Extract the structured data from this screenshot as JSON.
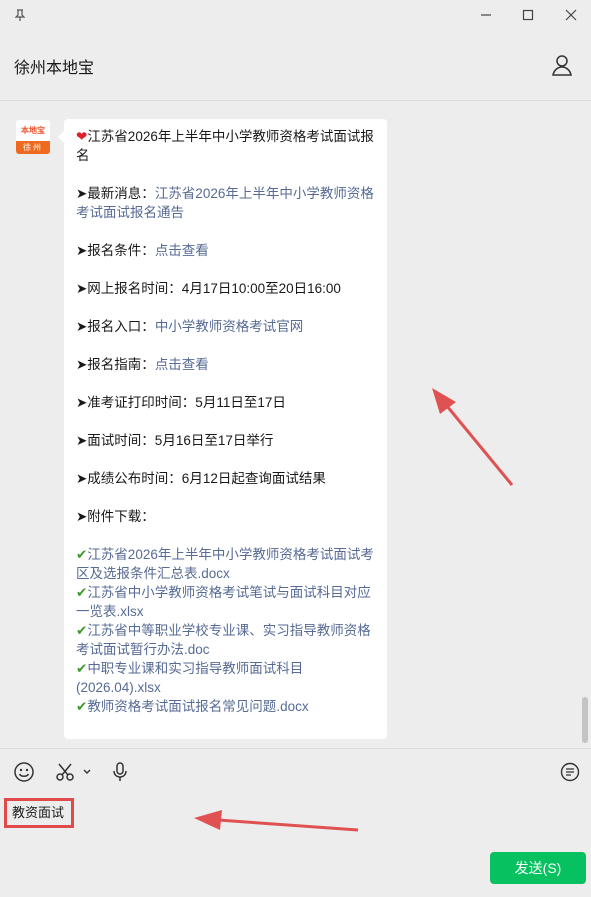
{
  "window": {
    "title": "徐州本地宝"
  },
  "avatar": {
    "top_text": "本地宝",
    "bottom_text": "徐州"
  },
  "message": {
    "title": "江苏省2026年上半年中小学教师资格考试面试报名",
    "items": [
      {
        "label": "➤最新消息：",
        "link": "江苏省2026年上半年中小学教师资格考试面试报名通告"
      },
      {
        "label": "➤报名条件：",
        "link": "点击查看"
      },
      {
        "text": "➤网上报名时间：4月17日10:00至20日16:00"
      },
      {
        "label": "➤报名入口：",
        "link": "中小学教师资格考试官网"
      },
      {
        "label": "➤报名指南：",
        "link": "点击查看"
      },
      {
        "text": "➤准考证打印时间：5月11日至17日"
      },
      {
        "text": "➤面试时间：5月16日至17日举行"
      },
      {
        "text": "➤成绩公布时间：6月12日起查询面试结果"
      },
      {
        "text": "➤附件下载："
      }
    ],
    "attachments": [
      "江苏省2026年上半年中小学教师资格考试面试考区及选报条件汇总表.docx",
      "江苏省中小学教师资格考试笔试与面试科目对应一览表.xlsx",
      "江苏省中等职业学校专业课、实习指导教师资格考试面试暂行办法.doc",
      "中职专业课和实习指导教师面试科目(2026.04).xlsx",
      "教师资格考试面试报名常见问题.docx"
    ]
  },
  "input": {
    "value": "教资面试"
  },
  "send_button": {
    "label": "发送(S)"
  },
  "colors": {
    "accent_green": "#07c160",
    "link": "#576b95",
    "highlight_red": "#e04a4a"
  }
}
